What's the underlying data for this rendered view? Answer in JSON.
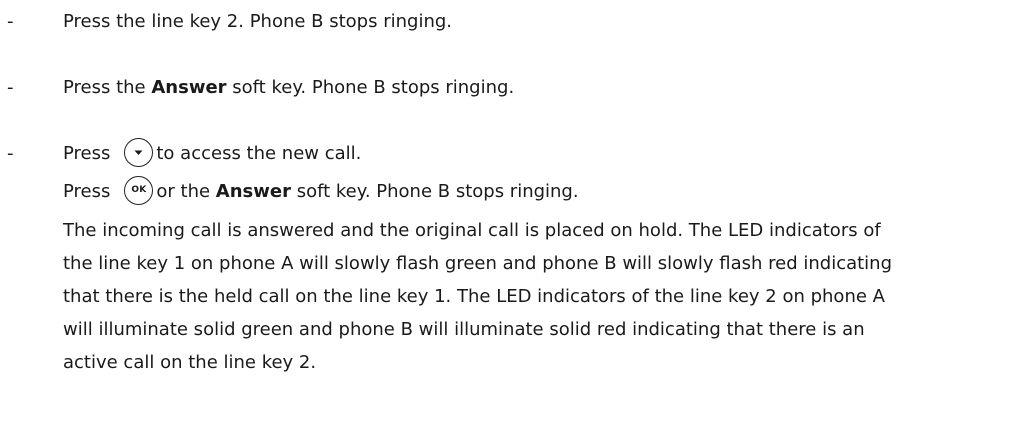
{
  "bullet_marker": "-",
  "steps": [
    {
      "text": "Press the line key 2. Phone B stops ringing."
    },
    {
      "pre": "Press the ",
      "bold": "Answer",
      "post": " soft key. Phone B stops ringing."
    },
    {
      "line1": {
        "pre": "Press",
        "icon": "down-arrow-key-icon",
        "post": "to access the new call."
      },
      "line2": {
        "pre": "Press",
        "icon": "ok-key-icon",
        "icon_label": "OK",
        "mid": "or the ",
        "bold": "Answer",
        "post": " soft key. Phone B stops ringing."
      },
      "paragraph_lines": [
        "The incoming call is answered and the original call is placed on hold. The LED indicators of",
        "the line key 1 on phone A will slowly flash green and phone B will slowly flash red indicating",
        "that there is the held call on the line key 1. The LED indicators of the line key 2 on phone A",
        "will illuminate solid green and phone B will illuminate solid red indicating that there is an",
        "active call on the line key 2."
      ]
    }
  ]
}
